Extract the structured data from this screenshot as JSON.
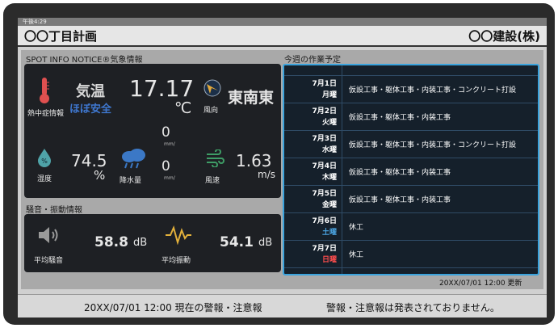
{
  "status_bar": {
    "time": "午後4:29"
  },
  "header": {
    "project_name": "〇〇丁目計画",
    "company_name": "〇〇建設(株)"
  },
  "weather": {
    "section_title": "SPOT INFO NOTICE®気象情報",
    "temperature": {
      "label": "気温",
      "status": "ほぼ安全",
      "value": "17.17",
      "unit": "℃",
      "icon_label": "熱中症情報"
    },
    "wind_direction": {
      "icon_label": "風向",
      "value": "東南東"
    },
    "humidity": {
      "icon_label": "湿度",
      "value": "74.5",
      "unit": "%"
    },
    "rainfall": {
      "icon_label": "降水量",
      "value_1": "0",
      "unit_1": "mm/",
      "value_2": "0",
      "unit_2": "mm/"
    },
    "wind_speed": {
      "icon_label": "風速",
      "value": "1.63",
      "unit": "m/s"
    }
  },
  "noise": {
    "section_title": "騒音・振動情報",
    "noise": {
      "icon_label": "平均騒音",
      "value": "58.8",
      "unit": "dB"
    },
    "vibration": {
      "icon_label": "平均振動",
      "value": "54.1",
      "unit": "dB"
    }
  },
  "schedule": {
    "section_title": "今週の作業予定",
    "rows": [
      {
        "date": "7月1日",
        "day": "月曜",
        "day_color": "#ffffff",
        "task": "仮設工事・躯体工事・内装工事・コンクリート打設"
      },
      {
        "date": "7月2日",
        "day": "火曜",
        "day_color": "#ffffff",
        "task": "仮設工事・躯体工事・内装工事"
      },
      {
        "date": "7月3日",
        "day": "水曜",
        "day_color": "#ffffff",
        "task": "仮設工事・躯体工事・内装工事・コンクリート打設"
      },
      {
        "date": "7月4日",
        "day": "木曜",
        "day_color": "#ffffff",
        "task": "仮設工事・躯体工事・内装工事"
      },
      {
        "date": "7月5日",
        "day": "金曜",
        "day_color": "#ffffff",
        "task": "仮設工事・躯体工事・内装工事"
      },
      {
        "date": "7月6日",
        "day": "土曜",
        "day_color": "#4aa3e0",
        "task": "休工"
      },
      {
        "date": "7月7日",
        "day": "日曜",
        "day_color": "#ff4d4d",
        "task": "休工"
      }
    ],
    "updated": "20XX/07/01 12:00 更新"
  },
  "alert": {
    "time_label": "20XX/07/01 12:00 現在の警報・注意報",
    "message": "警報・注意報は発表されておりません。"
  },
  "colors": {
    "accent": "#3aa3dd",
    "status_safe": "#3f78d1",
    "wind_arrow": "#e2a93b",
    "vibration": "#e2b03b",
    "thermo": "#e05050"
  }
}
